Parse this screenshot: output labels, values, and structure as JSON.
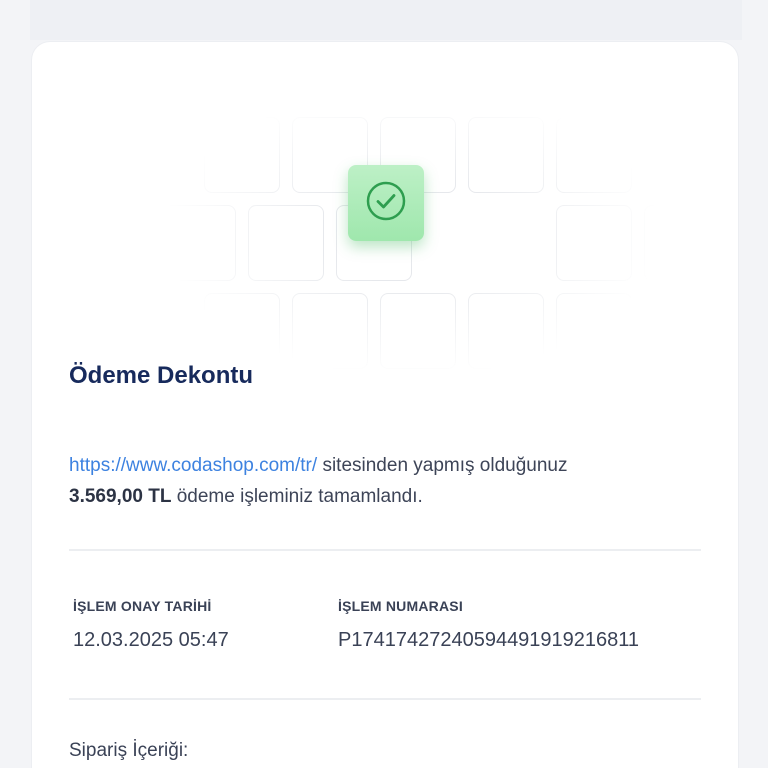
{
  "receipt": {
    "title": "Ödeme Dekontu",
    "message": {
      "link_text": "https://www.codashop.com/tr/",
      "text_after_link": " sitesinden yapmış olduğunuz",
      "amount": "3.569,00 TL",
      "text_after_amount": " ödeme işleminiz tamamlandı."
    },
    "approval_date": {
      "label": "İŞLEM ONAY TARİHİ",
      "value": "12.03.2025 05:47"
    },
    "transaction_number": {
      "label": "İŞLEM NUMARASI",
      "value": "P1741742724059449191921681​1"
    },
    "order_contents_label": "Sipariş İçeriği:"
  },
  "icons": {
    "success": "check-circle-icon"
  },
  "colors": {
    "title": "#172a5c",
    "link": "#3d82e0",
    "success_tile": "#a8e9b4",
    "success_icon": "#2e9e4f",
    "text": "#3a4256"
  }
}
